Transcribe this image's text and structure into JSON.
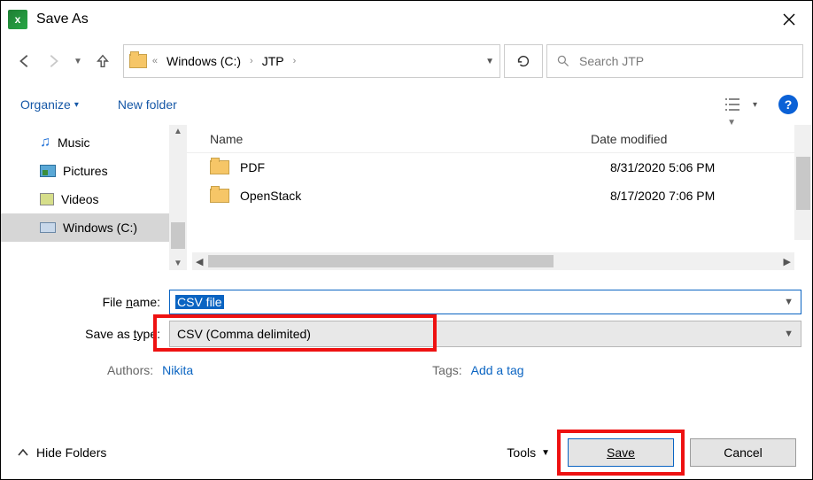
{
  "title": "Save As",
  "breadcrumb": {
    "root": "«",
    "drive": "Windows (C:)",
    "folder": "JTP"
  },
  "search": {
    "placeholder": "Search JTP"
  },
  "toolbar": {
    "organize": "Organize",
    "new_folder": "New folder"
  },
  "sidebar": {
    "items": [
      {
        "label": "Music"
      },
      {
        "label": "Pictures"
      },
      {
        "label": "Videos"
      },
      {
        "label": "Windows (C:)"
      }
    ]
  },
  "columns": {
    "name": "Name",
    "date": "Date modified"
  },
  "files": [
    {
      "name": "PDF",
      "date": "8/31/2020 5:06 PM"
    },
    {
      "name": "OpenStack",
      "date": "8/17/2020 7:06 PM"
    }
  ],
  "form": {
    "file_name_label": "File name:",
    "file_name_value": "CSV file",
    "save_type_label": "Save as type:",
    "save_type_value": "CSV (Comma delimited)",
    "authors_label": "Authors:",
    "authors_value": "Nikita",
    "tags_label": "Tags:",
    "tags_value": "Add a tag"
  },
  "bottom": {
    "hide_folders": "Hide Folders",
    "tools": "Tools",
    "save": "Save",
    "cancel": "Cancel"
  }
}
